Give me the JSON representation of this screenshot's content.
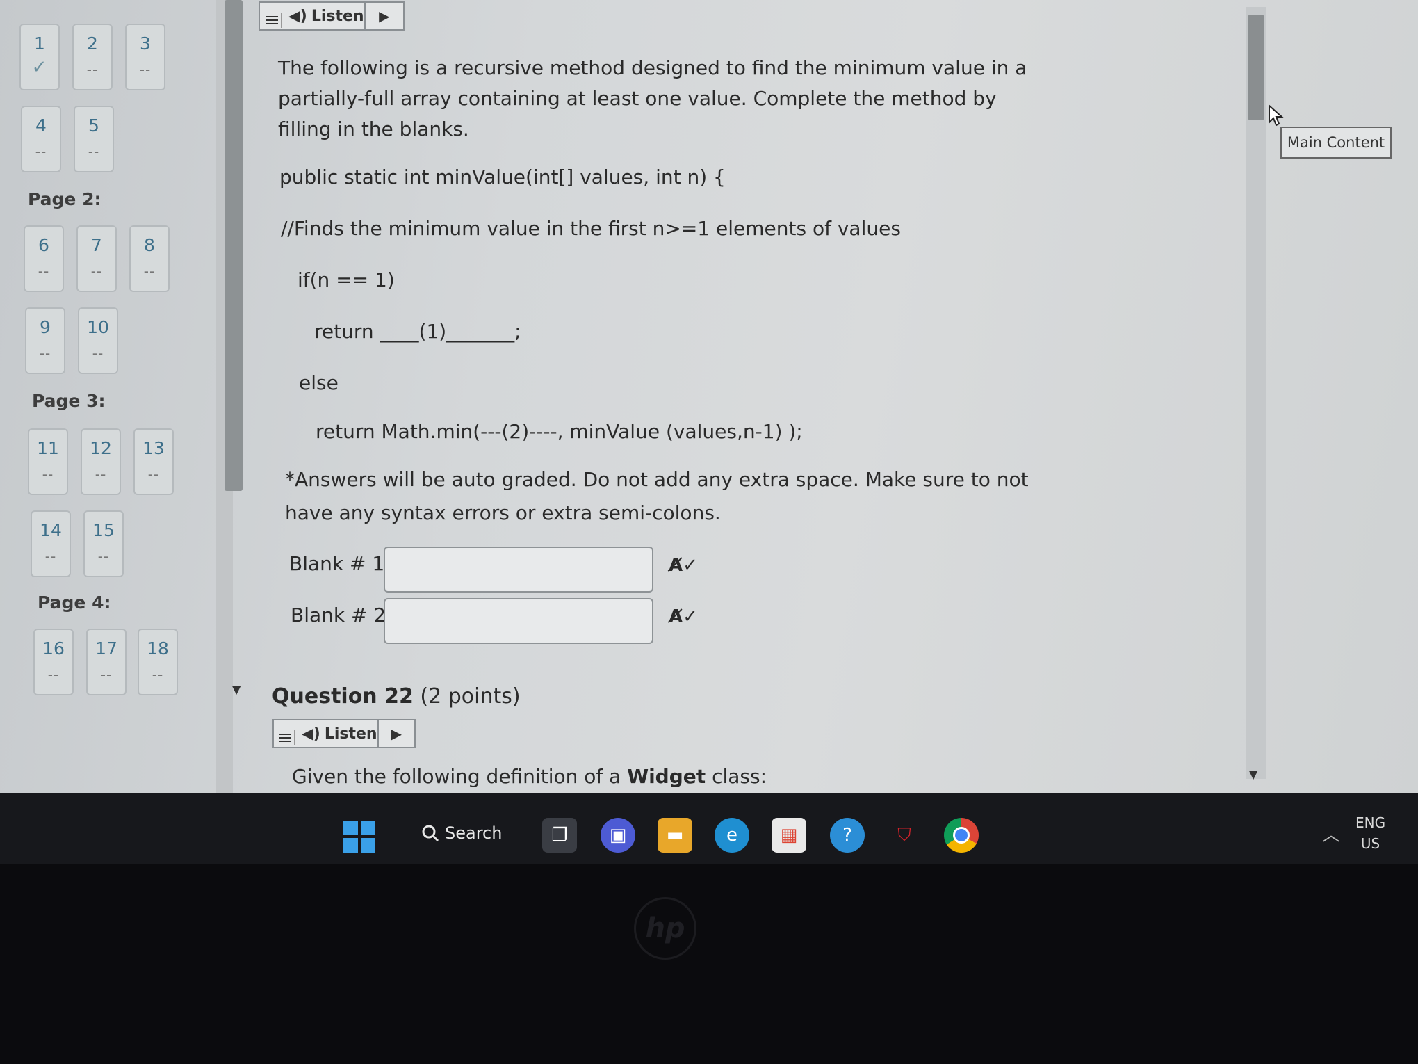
{
  "nav": {
    "items": [
      {
        "num": "1",
        "state": "✓"
      },
      {
        "num": "2",
        "state": "--"
      },
      {
        "num": "3",
        "state": "--"
      },
      {
        "num": "4",
        "state": "--"
      },
      {
        "num": "5",
        "state": "--"
      },
      {
        "num": "6",
        "state": "--"
      },
      {
        "num": "7",
        "state": "--"
      },
      {
        "num": "8",
        "state": "--"
      },
      {
        "num": "9",
        "state": "--"
      },
      {
        "num": "10",
        "state": "--"
      },
      {
        "num": "11",
        "state": "--"
      },
      {
        "num": "12",
        "state": "--"
      },
      {
        "num": "13",
        "state": "--"
      },
      {
        "num": "14",
        "state": "--"
      },
      {
        "num": "15",
        "state": "--"
      },
      {
        "num": "16",
        "state": "--"
      },
      {
        "num": "17",
        "state": "--"
      },
      {
        "num": "18",
        "state": "--"
      }
    ],
    "pages": [
      "Page 2:",
      "Page 3:",
      "Page 4:"
    ]
  },
  "listen_label": "Listen",
  "question": {
    "intro": "The following is a recursive method designed to find the minimum value in a partially-full array containing at least one value. Complete the method by filling in the blanks.",
    "code": [
      "public static int minValue(int[] values, int n) {",
      "//Finds the minimum value in the first n>=1 elements of values",
      "if(n == 1)",
      "return ____(1)_______;",
      "else",
      "return Math.min(---(2)----, minValue (values,n-1) );"
    ],
    "note": "*Answers will be auto graded. Do not add any extra space. Make sure to not have any syntax errors or extra semi-colons.",
    "blank1_label": "Blank # 1",
    "blank2_label": "Blank # 2",
    "blank1_value": "",
    "blank2_value": ""
  },
  "q22": {
    "title": "Question 22",
    "points": "(2 points)",
    "text_pre": "Given the following definition of a",
    "text_bold": "Widget",
    "text_post": "class:"
  },
  "main_content_button": "Main Content",
  "taskbar": {
    "search_label": "Search",
    "lang_top": "ENG",
    "lang_bottom": "US"
  },
  "icons": [
    "speaker-icon",
    "play-icon",
    "menu-icon",
    "spellcheck-icon",
    "windows-logo-icon",
    "search-icon",
    "task-view-icon",
    "meet-icon",
    "file-explorer-icon",
    "edge-icon",
    "store-icon",
    "help-icon",
    "mcafee-icon",
    "chrome-icon",
    "chevron-up-icon"
  ],
  "colors": {
    "accent": "#3d6f8a",
    "taskbar": "#17181c"
  }
}
